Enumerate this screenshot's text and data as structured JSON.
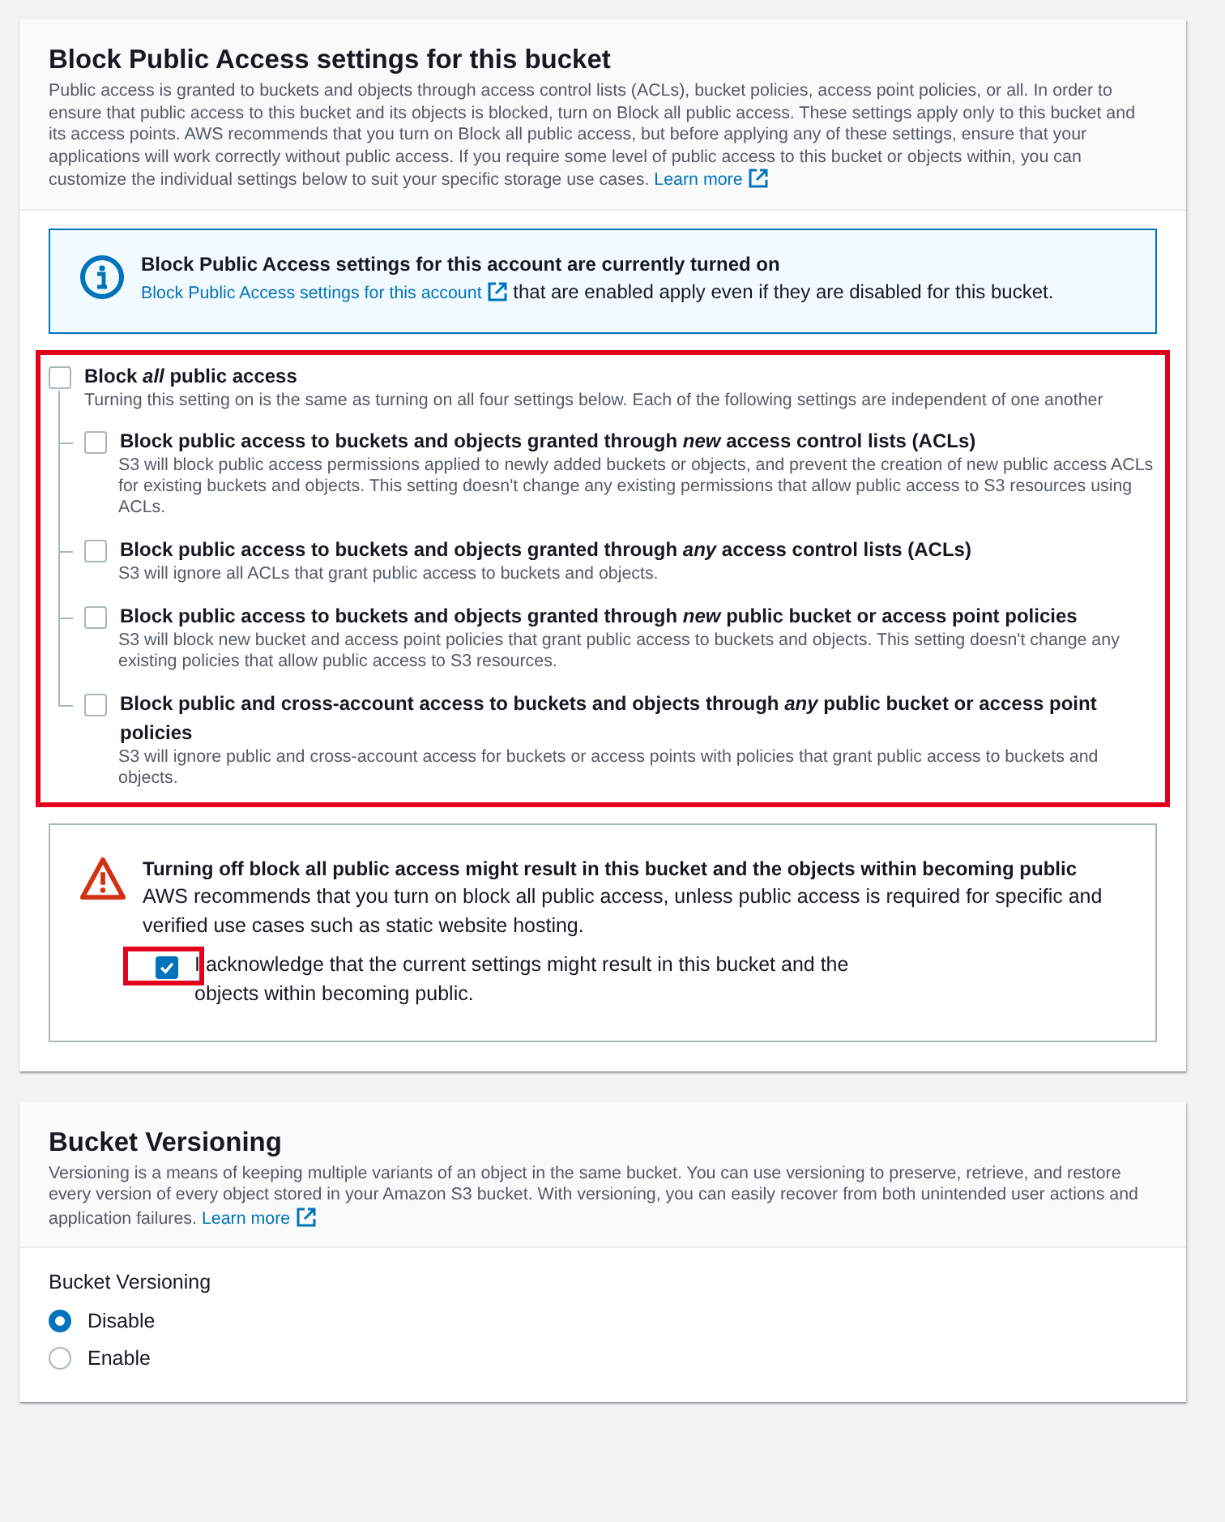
{
  "bpa_section": {
    "title": "Block Public Access settings for this bucket",
    "description": "Public access is granted to buckets and objects through access control lists (ACLs), bucket policies, access point policies, or all. In order to ensure that public access to this bucket and its objects is blocked, turn on Block all public access. These settings apply only to this bucket and its access points. AWS recommends that you turn on Block all public access, but before applying any of these settings, ensure that your applications will work correctly without public access. If you require some level of public access to this bucket or objects within, you can customize the individual settings below to suit your specific storage use cases.",
    "learn_more": "Learn more"
  },
  "account_alert": {
    "title": "Block Public Access settings for this account are currently turned on",
    "link": "Block Public Access settings for this account",
    "text": "that are enabled apply even if they are disabled for this bucket."
  },
  "block_all": {
    "label": "Block *all* public access",
    "checked": false,
    "highlighted": true,
    "description": "Turning this setting on is the same as turning on all four settings below. Each of the following settings are independent of one another"
  },
  "options": [
    {
      "label": "Block public access to buckets and objects granted through *new* access control lists (ACLs)",
      "description": "S3 will block public access permissions applied to newly added buckets or objects, and prevent the creation of new public access ACLs for existing buckets and objects. This setting doesn't change any existing permissions that allow public access to S3 resources using ACLs.",
      "checked": false
    },
    {
      "label": "Block public access to buckets and objects granted through *any* access control lists (ACLs)",
      "description": "S3 will ignore all ACLs that grant public access to buckets and objects.",
      "checked": false
    },
    {
      "label": "Block public access to buckets and objects granted through *new* public bucket or access point policies",
      "description": "S3 will block new bucket and access point policies that grant public access to buckets and objects. This setting doesn't change any existing policies that allow public access to S3 resources.",
      "checked": false
    },
    {
      "label": "Block public and cross-account access to buckets and objects through *any* public bucket or access point policies",
      "description": "S3 will ignore public and cross-account access for buckets or access points with policies that grant public access to buckets and objects.",
      "checked": false
    }
  ],
  "warning": {
    "title": "Turning off block all public access might result in this bucket and the objects within becoming public",
    "text": "AWS recommends that you turn on block all public access, unless public access is required for specific and verified use cases such as static website hosting.",
    "acknowledge": {
      "label": "I acknowledge that the current settings might result in this bucket and the objects within becoming public.",
      "checked": true,
      "highlighted": true
    }
  },
  "versioning": {
    "title": "Bucket Versioning",
    "description": "Versioning is a means of keeping multiple variants of an object in the same bucket. You can use versioning to preserve, retrieve, and restore every version of every object stored in your Amazon S3 bucket. With versioning, you can easily recover from both unintended user actions and application failures.",
    "learn_more": "Learn more",
    "field_label": "Bucket Versioning",
    "options": [
      {
        "label": "Disable",
        "selected": true
      },
      {
        "label": "Enable",
        "selected": false
      }
    ]
  }
}
